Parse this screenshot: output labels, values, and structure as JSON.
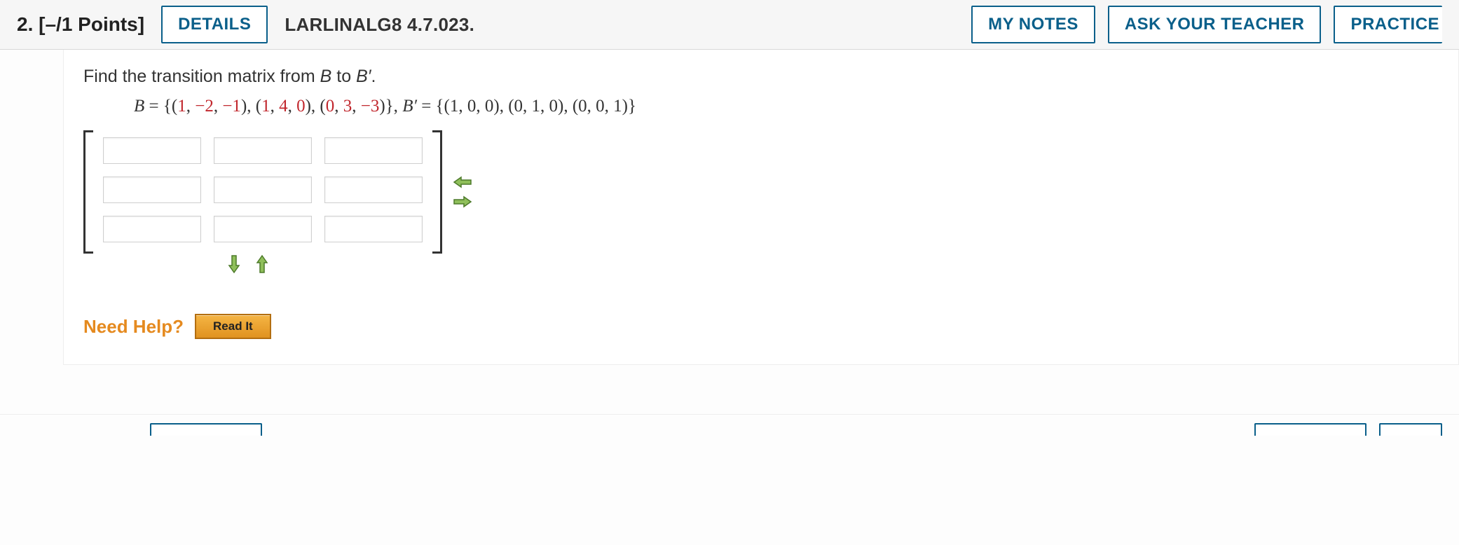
{
  "header": {
    "question_number": "2.",
    "points_label": "[–/1 Points]",
    "details_label": "DETAILS",
    "reference_code": "LARLINALG8 4.7.023.",
    "my_notes_label": "MY NOTES",
    "ask_teacher_label": "ASK YOUR TEACHER",
    "practice_label": "PRACTICE"
  },
  "prompt": {
    "text_before": "Find the transition matrix from ",
    "B": "B",
    "to": " to ",
    "Bprime": "B′",
    "period": "."
  },
  "equation": {
    "B_label": "B",
    "equals": " = ",
    "open": "{(",
    "v1": {
      "a": "1",
      "b": "−2",
      "c": "−1"
    },
    "v2": {
      "a": "1",
      "b": "4",
      "c": "0"
    },
    "v3": {
      "a": "0",
      "b": "3",
      "c": "−3"
    },
    "close": ")}",
    "Bprime_label": "B′",
    "bprime_set": "{(1, 0, 0), (0, 1, 0), (0, 0, 1)}"
  },
  "matrix": {
    "rows": 3,
    "cols": 3,
    "cells": [
      "",
      "",
      "",
      "",
      "",
      "",
      "",
      "",
      ""
    ]
  },
  "help": {
    "label": "Need Help?",
    "read_it": "Read It"
  }
}
